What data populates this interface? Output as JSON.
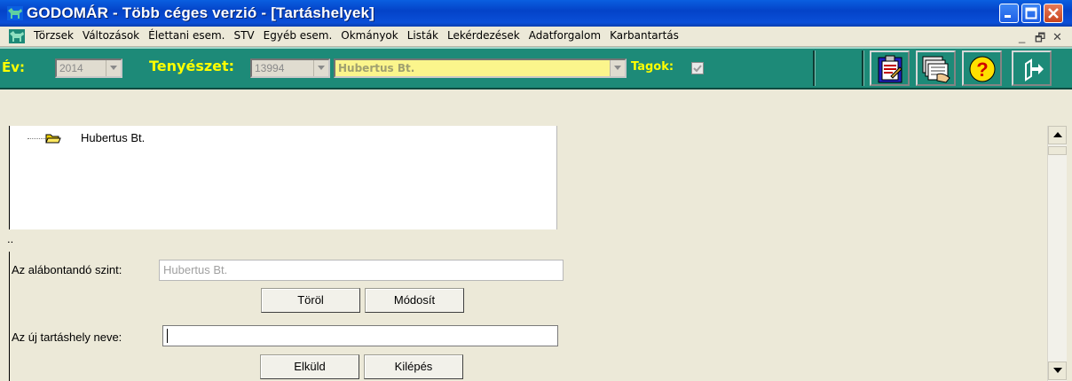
{
  "window": {
    "title": "GODOMÁR - Több céges verzió - [Tartáshelyek]",
    "accent": "#0443c8"
  },
  "menu": {
    "items": [
      "Törzsek",
      "Változások",
      "Élettani esem.",
      "STV",
      "Egyéb esem.",
      "Okmányok",
      "Listák",
      "Lekérdezések",
      "Adatforgalom",
      "Karbantartás"
    ],
    "minimize_glyph": "_",
    "restore_glyph": "🗗",
    "close_glyph": "✕"
  },
  "toolbar": {
    "year_label": "Év:",
    "year_value": "2014",
    "farm_label": "Tenyészet:",
    "farm_id": "13994",
    "farm_name": "Hubertus Bt.",
    "members_label": "Tagok:",
    "members_checked": true,
    "toolbar_color": "#1d8a78",
    "label_color": "#ffff00",
    "icons": [
      "clipboard-icon",
      "documents-hand-icon",
      "help-icon",
      "exit-icon"
    ]
  },
  "tree": {
    "root_label": "Hubertus Bt."
  },
  "status": {
    "dots": ".."
  },
  "form": {
    "level_label": "Az alábontandó szint:",
    "level_value": "Hubertus Bt.",
    "delete_button": "Töröl",
    "modify_button": "Módosít",
    "new_name_label": "Az új tartáshely neve:",
    "new_name_value": "",
    "send_button": "Elküld",
    "exit_button": "Kilépés"
  }
}
